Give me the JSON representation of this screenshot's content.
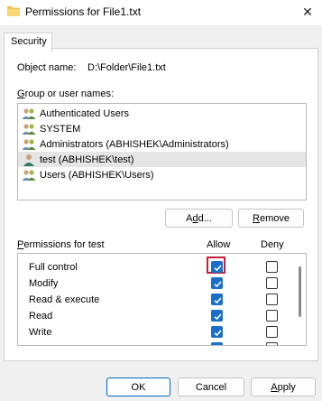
{
  "window": {
    "title": "Permissions for File1.txt",
    "close_glyph": "✕"
  },
  "tabs": [
    {
      "label": "Security"
    }
  ],
  "object": {
    "label": "Object name:",
    "value": "D:\\Folder\\File1.txt"
  },
  "groups": {
    "label_prefix": "G",
    "label_rest": "roup or user names:",
    "items": [
      {
        "label": "Authenticated Users",
        "icon": "users-icon",
        "selected": false
      },
      {
        "label": "SYSTEM",
        "icon": "users-icon",
        "selected": false
      },
      {
        "label": "Administrators (ABHISHEK\\Administrators)",
        "icon": "users-icon",
        "selected": false
      },
      {
        "label": "test (ABHISHEK\\test)",
        "icon": "user-icon",
        "selected": true
      },
      {
        "label": "Users (ABHISHEK\\Users)",
        "icon": "users-icon",
        "selected": false
      }
    ],
    "add_prefix": "A",
    "add_underline": "d",
    "add_rest": "d...",
    "remove_prefix": "",
    "remove_underline": "R",
    "remove_rest": "emove"
  },
  "permissions": {
    "label_prefix": "",
    "label_underline": "P",
    "label_rest": "ermissions for test",
    "allow_header": "Allow",
    "deny_header": "Deny",
    "rows": [
      {
        "name": "Full control",
        "allow": true,
        "deny": false,
        "focused": true
      },
      {
        "name": "Modify",
        "allow": true,
        "deny": false,
        "focused": false
      },
      {
        "name": "Read & execute",
        "allow": true,
        "deny": false,
        "focused": false
      },
      {
        "name": "Read",
        "allow": true,
        "deny": false,
        "focused": false
      },
      {
        "name": "Write",
        "allow": true,
        "deny": false,
        "focused": false
      },
      {
        "name": "",
        "allow": true,
        "deny": false,
        "focused": false
      }
    ]
  },
  "footer": {
    "ok": "OK",
    "cancel": "Cancel",
    "apply_underline": "A",
    "apply_rest": "pply"
  },
  "colors": {
    "accent": "#1a6fc9",
    "focus": "#c0213a",
    "folder": "#f2c14e"
  }
}
